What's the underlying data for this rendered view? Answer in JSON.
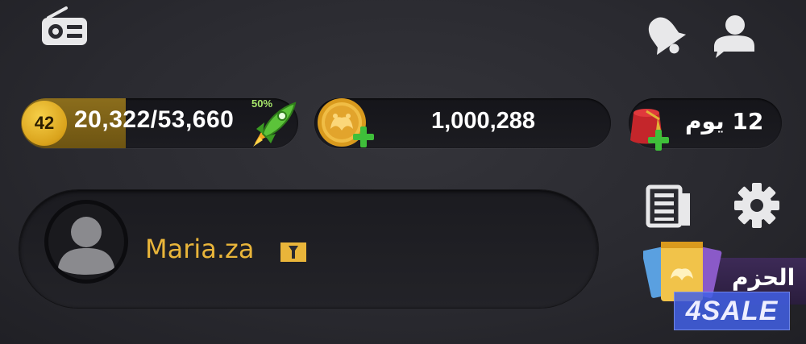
{
  "top_bar": {
    "radio_icon": "radio-icon",
    "bell_icon": "bell-icon",
    "profile_icon": "profile-chat-icon"
  },
  "xp": {
    "level": "42",
    "progress_text": "20,322/53,660",
    "progress_fraction": 0.379,
    "boost_percent": "50%",
    "boost_icon": "rocket-icon"
  },
  "coins": {
    "amount": "1,000,288",
    "icon": "coin-plus-icon"
  },
  "vip": {
    "days_text": "12 يوم",
    "icon": "fez-plus-icon"
  },
  "profile": {
    "username": "Maria.za",
    "avatar_icon": "avatar-placeholder",
    "badge_icon": "gold-badge-icon"
  },
  "side_icons": {
    "news_icon": "news-icon",
    "settings_icon": "gear-icon"
  },
  "packages": {
    "label": "الحزم"
  },
  "watermark": {
    "text": "4SALE"
  },
  "colors": {
    "gold": "#e9b53a",
    "xp_fill": "#8b6d1c",
    "green_plus": "#3fbf3a",
    "packages_bg": "#3d2a57"
  }
}
